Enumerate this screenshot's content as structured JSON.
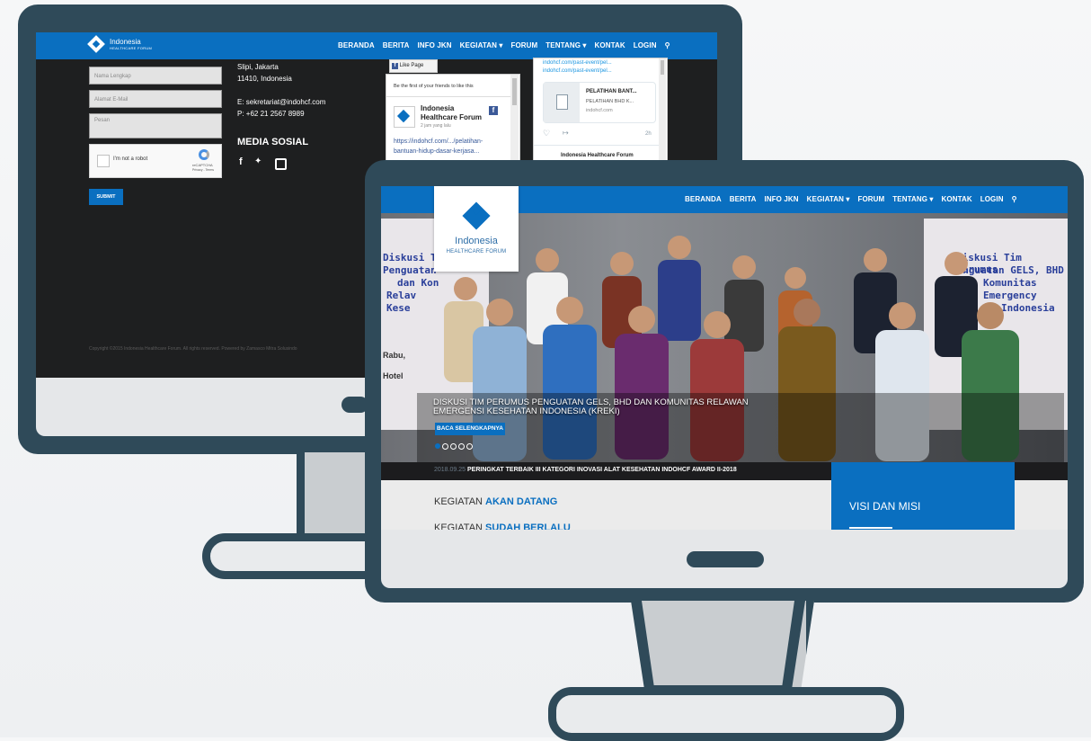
{
  "back_site": {
    "logo": {
      "line1": "Indonesia",
      "line2": "HEALTHCARE FORUM"
    },
    "nav": [
      "BERANDA",
      "BERITA",
      "INFO JKN",
      "KEGIATAN ▾",
      "FORUM",
      "TENTANG ▾",
      "KONTAK",
      "LOGIN"
    ],
    "form": {
      "name_placeholder": "Nama Lengkap",
      "email_placeholder": "Alamat E-Mail",
      "message_placeholder": "Pesan",
      "captcha_label": "I'm not a robot",
      "captcha_brand": "reCAPTCHA",
      "captcha_links": "Privacy - Terms",
      "submit_label": "SUBMIT"
    },
    "contact": {
      "address1": "Slipi, Jakarta",
      "address2": "11410, Indonesia",
      "email": "E: sekretariat@indohcf.com",
      "phone": "P: +62 21 2567 8989"
    },
    "social_heading": "MEDIA SOSIAL",
    "social_icons": [
      "facebook-icon",
      "twitter-icon",
      "instagram-icon"
    ],
    "copyright": "Copyright ©2015 Indonesia Healthcare Forum. All rights reserved. Powered by Zamasco Mitra Solusindo",
    "fb_widget": {
      "like_button": "Like Page",
      "friends_text": "Be the first of your friends to like this",
      "page_name1": "Indonesia",
      "page_name2": "Healthcare Forum",
      "time": "2 jam yang lalu",
      "link1": "https://indohcf.com/.../pelatihan-",
      "link2": "bantuan-hidup-dasar-kerjasa..."
    },
    "tweet_widget": {
      "link1": "indohcf.com/past-event/pel...",
      "link2": "indohcf.com/past-event/pel...",
      "card_title": "PELATIHAN BANT...",
      "card_desc": "PELATIHAN BHD K...",
      "card_domain": "indohcf.com",
      "time": "2h",
      "author": "Indonesia Healthcare Forum"
    }
  },
  "front_site": {
    "logo": {
      "line1": "Indonesia",
      "line2": "HEALTHCARE FORUM"
    },
    "nav": [
      "BERANDA",
      "BERITA",
      "INFO JKN",
      "KEGIATAN ▾",
      "FORUM",
      "TENTANG ▾",
      "KONTAK",
      "LOGIN"
    ],
    "hero": {
      "banner_left": [
        "Diskusi Tim",
        "Penguatan",
        "dan Kon",
        "Relav",
        "Kese"
      ],
      "banner_right": [
        "Diskusi Tim Perumus",
        "Penguatan GELS, BHD",
        "Komunitas",
        "Emergency",
        "Indonesia"
      ],
      "banner_bottom": [
        "Rabu,",
        "Hotel"
      ],
      "caption": "DISKUSI TIM PERUMUS PENGUATAN GELS, BHD DAN KOMUNITAS RELAWAN EMERGENSI KESEHATAN INDONESIA (KREKI)",
      "button": "BACA SELENGKAPNYA",
      "dots": 5
    },
    "ticker": {
      "date": "2018.09.25",
      "text": "PERINGKAT TERBAIK III KATEGORI INOVASI ALAT KESEHATAN INDOHCF AWARD II-2018"
    },
    "sections": [
      {
        "prefix": "KEGIATAN ",
        "highlight": "AKAN DATANG"
      },
      {
        "prefix": "KEGIATAN ",
        "highlight": "SUDAH BERLALU"
      }
    ],
    "sidebar_title": "VISI DAN MISI"
  },
  "colors": {
    "brand_blue": "#0a6fc0",
    "frame": "#2f4a59",
    "dark_bg": "#1e1f20"
  }
}
